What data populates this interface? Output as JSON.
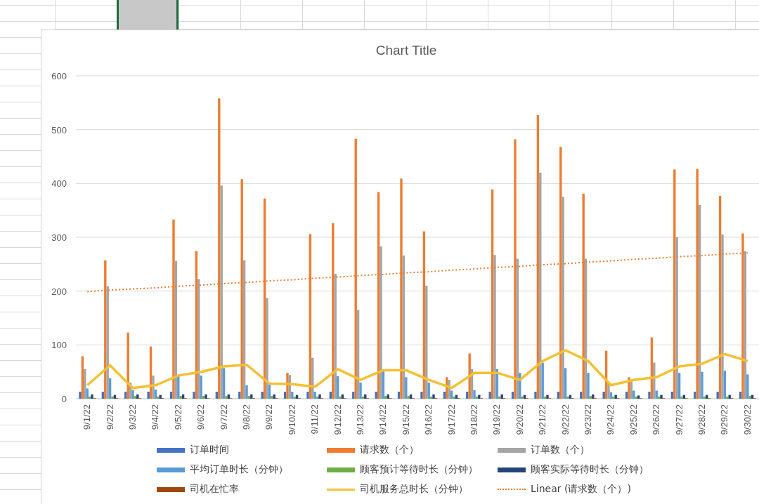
{
  "sheet": {
    "top_row": [
      {
        "selected": false
      },
      {
        "selected": true
      },
      {
        "selected": false
      },
      {
        "selected": false
      },
      {
        "selected": false
      },
      {
        "selected": false
      },
      {
        "selected": false
      },
      {
        "selected": false
      },
      {
        "selected": false
      },
      {
        "selected": false
      },
      {
        "selected": false
      },
      {
        "selected": false
      }
    ]
  },
  "chart": {
    "chart_data": {
      "type": "bar",
      "title": "Chart Title",
      "grid": true,
      "categories": [
        "9/1/22",
        "9/2/22",
        "9/3/22",
        "9/4/22",
        "9/5/22",
        "9/6/22",
        "9/7/22",
        "9/8/22",
        "9/9/22",
        "9/10/22",
        "9/11/22",
        "9/12/22",
        "9/13/22",
        "9/14/22",
        "9/15/22",
        "9/16/22",
        "9/17/22",
        "9/18/22",
        "9/19/22",
        "9/20/22",
        "9/21/22",
        "9/22/22",
        "9/23/22",
        "9/24/22",
        "9/25/22",
        "9/26/22",
        "9/27/22",
        "9/28/22",
        "9/29/22",
        "9/30/22"
      ],
      "ylim": [
        0,
        600
      ],
      "yticks": [
        0,
        100,
        200,
        300,
        400,
        500,
        600
      ],
      "series": [
        {
          "name": "订单时间",
          "type": "bar",
          "color": "#4472c4",
          "values": [
            13,
            13,
            13,
            13,
            13,
            13,
            13,
            13,
            13,
            13,
            13,
            13,
            13,
            13,
            13,
            13,
            13,
            13,
            13,
            13,
            13,
            13,
            13,
            13,
            13,
            13,
            13,
            13,
            13,
            13
          ]
        },
        {
          "name": "请求数（个）",
          "type": "bar",
          "color": "#ed7d31",
          "values": [
            79,
            257,
            123,
            97,
            333,
            274,
            558,
            408,
            372,
            48,
            306,
            326,
            483,
            384,
            409,
            311,
            40,
            84,
            389,
            482,
            527,
            468,
            381,
            89,
            40,
            114,
            426,
            427,
            377,
            307
          ]
        },
        {
          "name": "订单数（个）",
          "type": "bar",
          "color": "#a5a5a5",
          "values": [
            55,
            209,
            30,
            43,
            256,
            222,
            396,
            257,
            187,
            44,
            76,
            232,
            165,
            283,
            266,
            210,
            35,
            55,
            267,
            260,
            420,
            375,
            260,
            30,
            35,
            67,
            300,
            360,
            305,
            274
          ]
        },
        {
          "name": "平均订单时长（分钟）",
          "type": "bar",
          "color": "#5b9bd5",
          "values": [
            19,
            38,
            16,
            17,
            42,
            43,
            57,
            25,
            26,
            13,
            13,
            42,
            30,
            52,
            40,
            30,
            15,
            16,
            55,
            48,
            67,
            57,
            48,
            12,
            15,
            15,
            48,
            50,
            52,
            45
          ]
        },
        {
          "name": "顾客预计等待时长（分钟）",
          "type": "bar",
          "color": "#70ad47",
          "values": [
            4,
            4,
            5,
            4,
            5,
            5,
            5,
            5,
            5,
            4,
            4,
            4,
            4,
            5,
            5,
            4,
            4,
            4,
            4,
            4,
            4,
            4,
            5,
            4,
            4,
            4,
            4,
            4,
            4,
            5
          ]
        },
        {
          "name": "顾客实际等待时长（分钟）",
          "type": "bar",
          "color": "#264478",
          "values": [
            8,
            7,
            8,
            7,
            8,
            8,
            8,
            8,
            8,
            7,
            8,
            8,
            8,
            8,
            8,
            8,
            7,
            7,
            8,
            7,
            7,
            7,
            8,
            7,
            6,
            7,
            7,
            7,
            7,
            7
          ]
        },
        {
          "name": "司机在忙率",
          "type": "bar",
          "color": "#9e480e",
          "values": [
            1,
            1,
            1,
            1,
            1,
            1,
            1,
            1,
            1,
            1,
            1,
            1,
            1,
            1,
            1,
            1,
            1,
            1,
            1,
            1,
            1,
            1,
            1,
            1,
            1,
            1,
            1,
            1,
            1,
            1
          ]
        },
        {
          "name": "司机服务总时长（分钟）",
          "type": "line",
          "color": "#f5c033",
          "values": [
            25,
            62,
            20,
            25,
            43,
            50,
            60,
            63,
            28,
            27,
            22,
            55,
            35,
            53,
            53,
            35,
            20,
            48,
            48,
            35,
            70,
            90,
            70,
            25,
            35,
            40,
            60,
            65,
            83,
            70
          ]
        },
        {
          "name": "Linear (请求数（个）)",
          "type": "line",
          "line_style": "dotted",
          "color": "#ed7d31",
          "values": [
            199,
            202,
            204,
            206,
            209,
            211,
            214,
            216,
            219,
            221,
            224,
            226,
            229,
            231,
            234,
            236,
            239,
            241,
            244,
            246,
            249,
            251,
            254,
            256,
            259,
            261,
            264,
            266,
            269,
            271
          ]
        }
      ]
    }
  }
}
